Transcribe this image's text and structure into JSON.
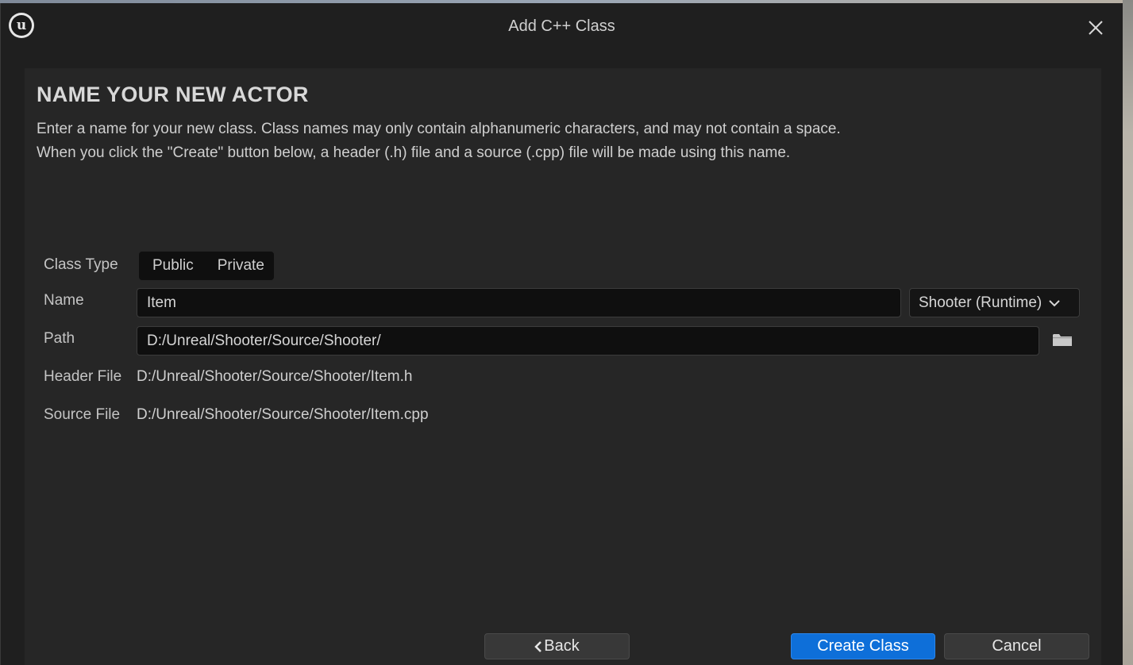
{
  "window": {
    "title": "Add C++ Class",
    "logo_glyph": "u"
  },
  "page": {
    "heading": "NAME YOUR NEW ACTOR",
    "desc_line1": "Enter a name for your new class. Class names may only contain alphanumeric characters, and may not contain a space.",
    "desc_line2": "When you click the \"Create\" button below, a header (.h) file and a source (.cpp) file will be made using this name."
  },
  "form": {
    "class_type_label": "Class Type",
    "class_type_options": [
      "Public",
      "Private"
    ],
    "name_label": "Name",
    "name_value": "Item",
    "module_selected": "Shooter (Runtime)",
    "path_label": "Path",
    "path_value": "D:/Unreal/Shooter/Source/Shooter/",
    "header_label": "Header File",
    "header_value": "D:/Unreal/Shooter/Source/Shooter/Item.h",
    "source_label": "Source File",
    "source_value": "D:/Unreal/Shooter/Source/Shooter/Item.cpp"
  },
  "buttons": {
    "back": "Back",
    "create": "Create Class",
    "cancel": "Cancel"
  },
  "icons": {
    "close": "close-icon",
    "folder": "folder-icon",
    "chevron": "chevron-down-icon",
    "back_arrow": "chevron-left-icon"
  },
  "colors": {
    "accent": "#0e6fd9",
    "window_bg": "#1f1f1f",
    "panel_bg": "#262626",
    "field_bg": "#0f0f0f"
  }
}
